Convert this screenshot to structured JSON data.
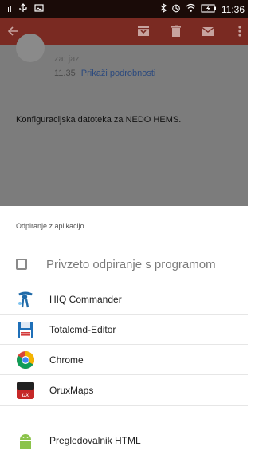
{
  "status_bar": {
    "signal_text": "ııl",
    "time": "11:36"
  },
  "email": {
    "to": "za: jaz",
    "time": "11.35",
    "details_link": "Prikaži podrobnosti",
    "body": "Konfiguracijska datoteka za NEDO HEMS."
  },
  "sheet": {
    "title": "Odpiranje z aplikacijo",
    "always_label": "Privzeto odpiranje s programom",
    "apps": [
      {
        "label": "HIQ Commander"
      },
      {
        "label": "Totalcmd-Editor"
      },
      {
        "label": "Chrome"
      },
      {
        "label": "OruxMaps"
      },
      {
        "label": "Pregledovalnik HTML"
      }
    ]
  }
}
